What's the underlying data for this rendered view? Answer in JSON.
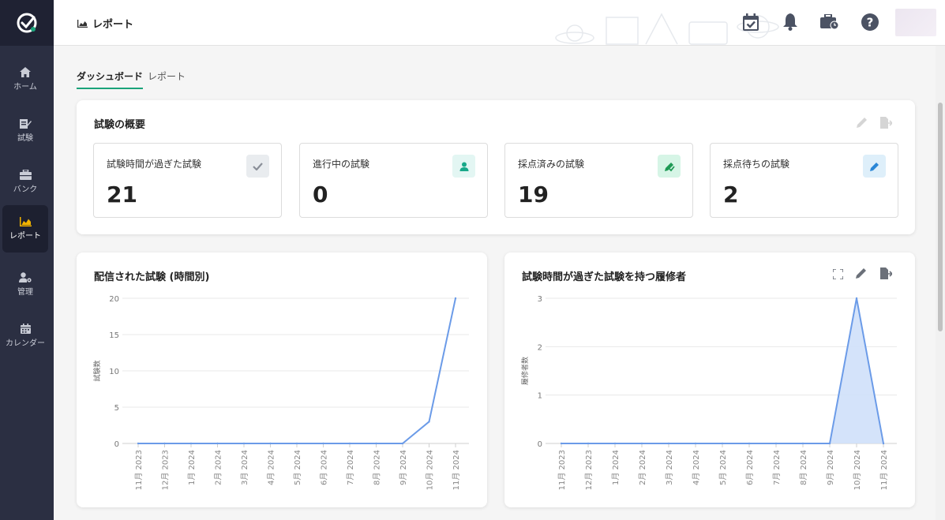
{
  "header": {
    "title": "レポート"
  },
  "sidebar": {
    "items": [
      {
        "label": "ホーム"
      },
      {
        "label": "試験"
      },
      {
        "label": "バンク"
      },
      {
        "label": "レポート"
      },
      {
        "label": "管理"
      },
      {
        "label": "カレンダー"
      }
    ]
  },
  "tabs": [
    {
      "label": "ダッシュボード"
    },
    {
      "label": "レポート"
    }
  ],
  "overview": {
    "title": "試験の概要",
    "stats": [
      {
        "label": "試験時間が過ぎた試験",
        "value": "21",
        "icon": "check-icon",
        "color": "#e9ecef"
      },
      {
        "label": "進行中の試験",
        "value": "0",
        "icon": "person-icon",
        "color": "#e3f6f3"
      },
      {
        "label": "採点済みの試験",
        "value": "19",
        "icon": "pen-check-icon",
        "color": "#d6f5e6"
      },
      {
        "label": "採点待ちの試験",
        "value": "2",
        "icon": "pen-icon",
        "color": "#deeffa"
      }
    ]
  },
  "colors": {
    "accent": "#1aa37a",
    "line": "#6b9be8",
    "area": "#cfe0fa",
    "sidebar": "#2b2f42"
  },
  "chart_data": [
    {
      "type": "line",
      "title": "配信された試験 (時間別)",
      "ylabel": "試験数",
      "xlabel": "",
      "categories": [
        "11月 2023",
        "12月 2023",
        "1月 2024",
        "2月 2024",
        "3月 2024",
        "4月 2024",
        "5月 2024",
        "6月 2024",
        "7月 2024",
        "8月 2024",
        "9月 2024",
        "10月 2024",
        "11月 2024"
      ],
      "series": [
        {
          "values": [
            0,
            0,
            0,
            0,
            0,
            0,
            0,
            0,
            0,
            0,
            0,
            3,
            20
          ]
        }
      ],
      "ylim": [
        0,
        20
      ],
      "yticks": [
        0,
        5,
        10,
        15,
        20
      ],
      "grid": true
    },
    {
      "type": "area",
      "title": "試験時間が過ぎた試験を持つ履修者",
      "ylabel": "履修者数",
      "xlabel": "",
      "categories": [
        "11月 2023",
        "12月 2023",
        "1月 2024",
        "2月 2024",
        "3月 2024",
        "4月 2024",
        "5月 2024",
        "6月 2024",
        "7月 2024",
        "8月 2024",
        "9月 2024",
        "10月 2024",
        "11月 2024"
      ],
      "series": [
        {
          "values": [
            0,
            0,
            0,
            0,
            0,
            0,
            0,
            0,
            0,
            0,
            0,
            3,
            0
          ]
        }
      ],
      "ylim": [
        0,
        3
      ],
      "yticks": [
        0,
        1,
        2,
        3
      ],
      "grid": true
    }
  ]
}
